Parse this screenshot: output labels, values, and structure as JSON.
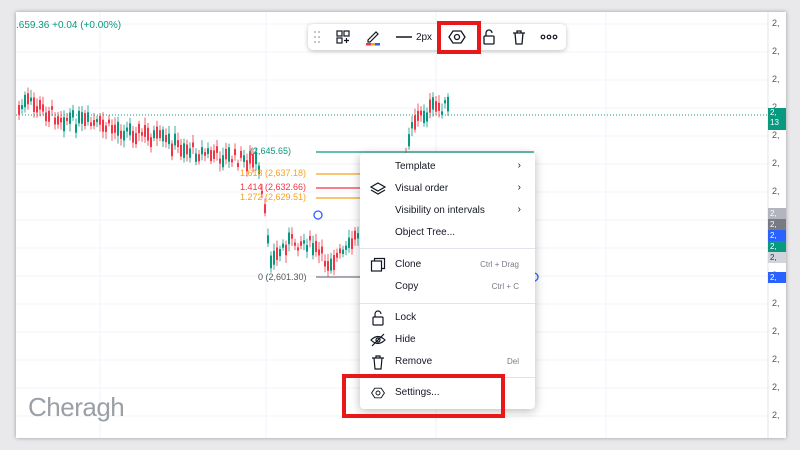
{
  "ohlc_text": ".659.36 +0.04 (+0.00%)",
  "colors": {
    "up": "#089981",
    "down": "#f23645",
    "fib_orange": "#f7a21b",
    "fib_red": "#f23645",
    "fib_teal": "#089981",
    "highlight": "#e8171a"
  },
  "toolbar": {
    "items": [
      {
        "name": "drag-handle",
        "icon": "grip-dots-icon"
      },
      {
        "name": "object-tree",
        "icon": "object-tree-icon"
      },
      {
        "name": "color",
        "icon": "pencil-icon"
      },
      {
        "name": "line-width",
        "icon": "line-icon",
        "label": "2px"
      },
      {
        "name": "settings",
        "icon": "settings-hexagon-icon"
      },
      {
        "name": "lock",
        "icon": "unlock-icon"
      },
      {
        "name": "delete",
        "icon": "trash-icon"
      },
      {
        "name": "more",
        "icon": "more-icon"
      }
    ],
    "width_label": "2px"
  },
  "fib_labels": {
    "l1": "(2,645.65)",
    "l2": "1.618 (2,637.18)",
    "l3": "1.414 (2,632.66)",
    "l4": "1.272 (2,629.51)",
    "l5": "0 (2,601.30)"
  },
  "price_axis": {
    "labels": [
      "2,",
      "2,",
      "2,",
      "2,",
      "2,",
      "2,",
      "2,",
      "2,",
      "2,",
      "2,",
      "2,",
      "2,",
      "2,",
      "2,",
      "2,",
      "2,"
    ],
    "tag_current_top": "2,",
    "tag_current_bottom": "13",
    "tags": [
      "2,",
      "2,",
      "2,",
      "2,",
      "2,",
      "2,"
    ]
  },
  "context_menu": {
    "template": "Template",
    "visual_order": "Visual order",
    "visibility": "Visibility on intervals",
    "object_tree": "Object Tree...",
    "clone": "Clone",
    "clone_sc": "Ctrl + Drag",
    "copy": "Copy",
    "copy_sc": "Ctrl + C",
    "lock": "Lock",
    "hide": "Hide",
    "remove": "Remove",
    "remove_sc": "Del",
    "settings": "Settings..."
  },
  "watermark": "Cheragh"
}
